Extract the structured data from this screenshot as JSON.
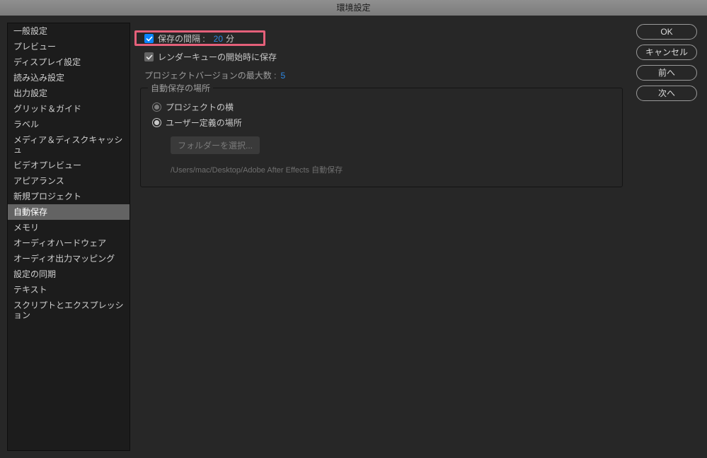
{
  "window": {
    "title": "環境設定"
  },
  "sidebar": {
    "items": [
      "一般設定",
      "プレビュー",
      "ディスプレイ設定",
      "読み込み設定",
      "出力設定",
      "グリッド＆ガイド",
      "ラベル",
      "メディア＆ディスクキャッシュ",
      "ビデオプレビュー",
      "アピアランス",
      "新規プロジェクト",
      "自動保存",
      "メモリ",
      "オーディオハードウェア",
      "オーディオ出力マッピング",
      "設定の同期",
      "テキスト",
      "スクリプトとエクスプレッション"
    ],
    "selectedIndex": 11
  },
  "main": {
    "saveInterval": {
      "label": "保存の間隔 :",
      "value": "20",
      "unit": "分"
    },
    "saveOnRenderQueue": {
      "label": "レンダーキューの開始時に保存"
    },
    "maxVersions": {
      "label": "プロジェクトバージョンの最大数 :",
      "value": "5"
    },
    "autoSaveLocation": {
      "title": "自動保存の場所",
      "options": [
        "プロジェクトの横",
        "ユーザー定義の場所"
      ],
      "folderButton": "フォルダーを選択...",
      "path": "/Users/mac/Desktop/Adobe After Effects 自動保存"
    }
  },
  "buttons": {
    "ok": "OK",
    "cancel": "キャンセル",
    "prev": "前へ",
    "next": "次へ"
  }
}
